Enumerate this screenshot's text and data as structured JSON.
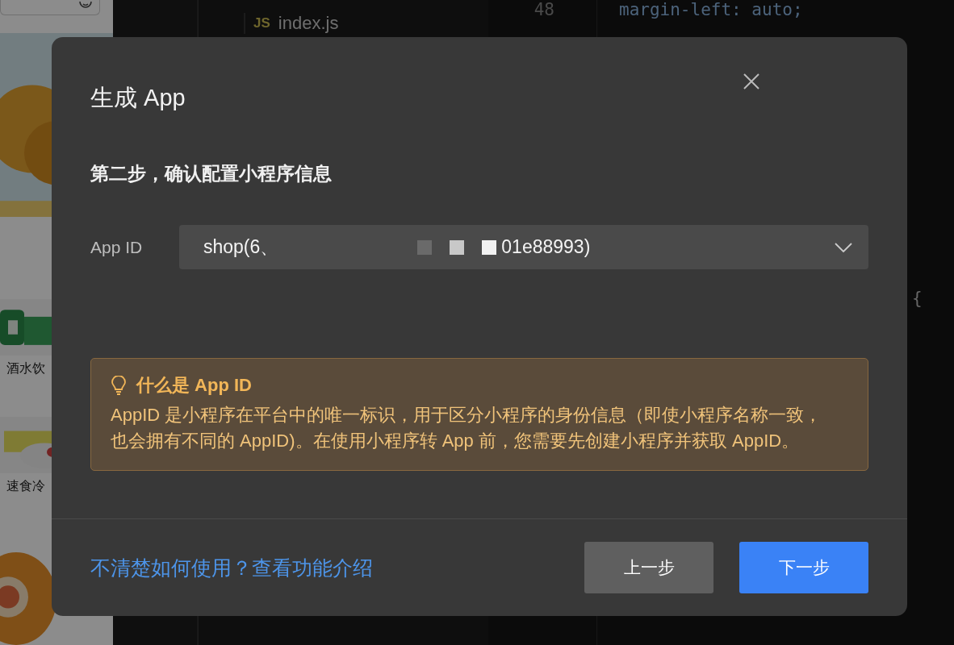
{
  "background": {
    "shop": {
      "categories": [
        {
          "label": "酒水饮"
        },
        {
          "label": "速食冷"
        }
      ]
    },
    "editor": {
      "file_tab": {
        "badge": "JS",
        "name": "index.js"
      },
      "line_numbers": [
        "48"
      ],
      "code_lines": [
        "margin-left: auto;"
      ],
      "stray_code": "{"
    }
  },
  "dialog": {
    "title": "生成 App",
    "step_title": "第二步，确认配置小程序信息",
    "fields": [
      {
        "label": "App ID",
        "value_start": "shop(6、",
        "value_end": "01e88993)"
      }
    ],
    "tip": {
      "title": "什么是 App ID",
      "body": "AppID 是小程序在平台中的唯一标识，用于区分小程序的身份信息（即使小程序名称一致，也会拥有不同的 AppID)。在使用小程序转 App 前，您需要先创建小程序并获取 AppID。"
    },
    "help_link": "不清楚如何使用？查看功能介绍",
    "buttons": [
      {
        "label": "上一步",
        "kind": "secondary"
      },
      {
        "label": "下一步",
        "kind": "primary"
      }
    ]
  }
}
